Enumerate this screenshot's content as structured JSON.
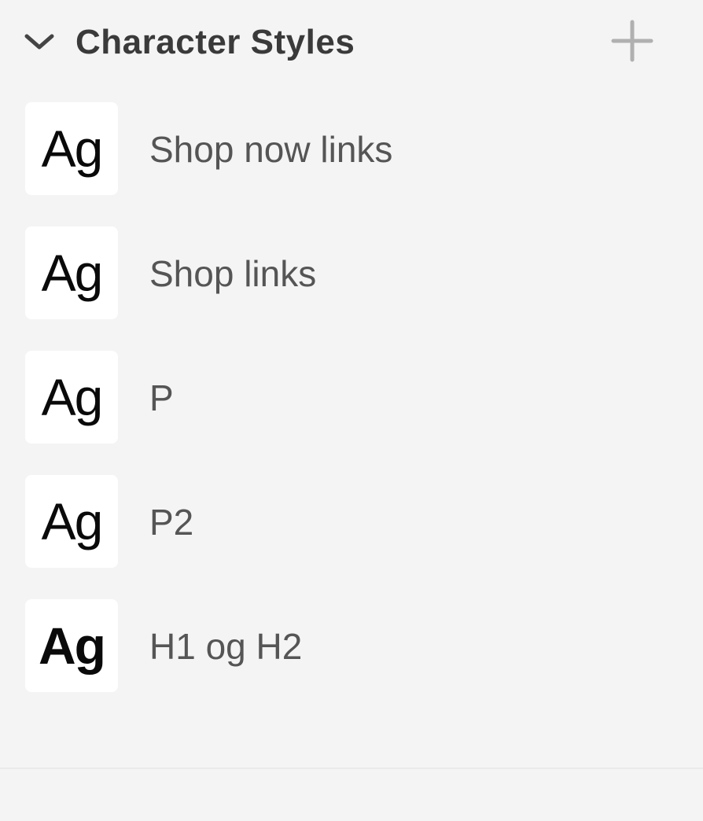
{
  "section": {
    "title": "Character Styles",
    "expanded": true,
    "collapse_icon": "chevron-down-icon",
    "add_icon": "plus-icon"
  },
  "styles": [
    {
      "preview": "Ag",
      "label": "Shop now links"
    },
    {
      "preview": "Ag",
      "label": "Shop links"
    },
    {
      "preview": "Ag",
      "label": "P"
    },
    {
      "preview": "Ag",
      "label": "P2"
    },
    {
      "preview": "Ag",
      "label": "H1 og H2"
    }
  ],
  "colors": {
    "background": "#f4f4f4",
    "swatch_background": "#ffffff",
    "title_text": "#3a3a3a",
    "label_text": "#555555",
    "icon": "#b0b0b0"
  }
}
